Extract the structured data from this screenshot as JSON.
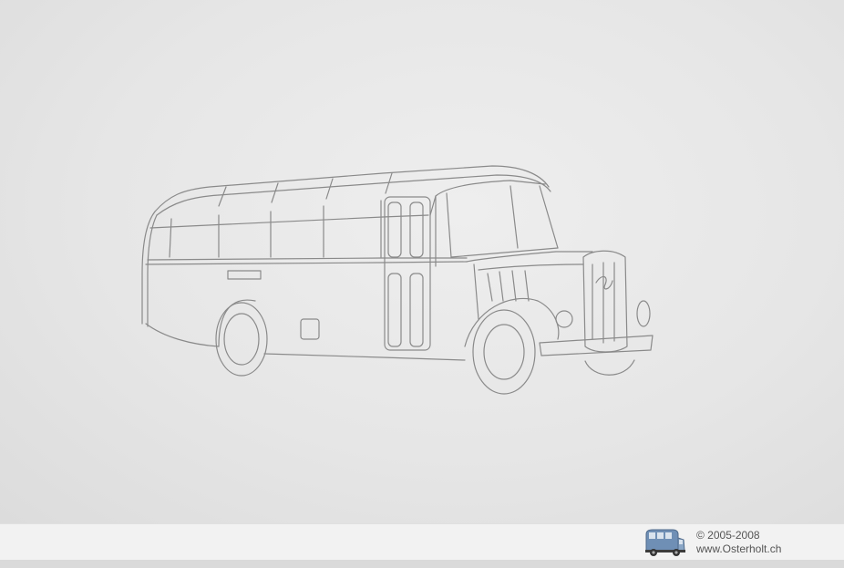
{
  "footer": {
    "copyright": "© 2005-2008",
    "website": "www.Osterholt.ch"
  },
  "sketch": {
    "hood_badge": "Saurer"
  },
  "colors": {
    "paper": "#e6e6e6",
    "footer_bg": "#f2f2f2",
    "pencil": "#8a8a8a",
    "logo_bus": "#6f8fb5"
  },
  "icons": {
    "logo": "bus-logo-icon"
  }
}
